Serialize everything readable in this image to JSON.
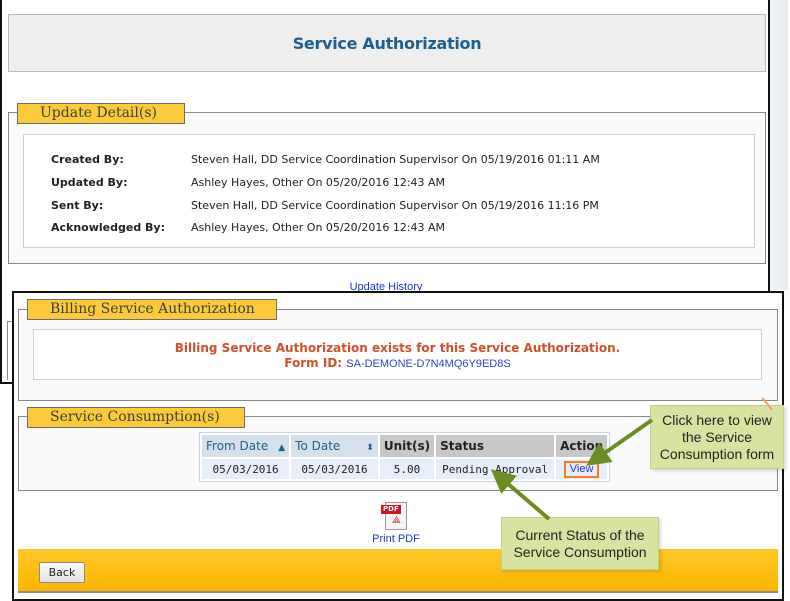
{
  "page": {
    "title": "Service Authorization"
  },
  "update_details": {
    "legend": "Update Detail(s)",
    "rows": [
      {
        "label": "Created By:",
        "value": "Steven Hall, DD Service Coordination Supervisor On 05/19/2016 01:11 AM"
      },
      {
        "label": "Updated By:",
        "value": "Ashley Hayes, Other On 05/20/2016 12:43 AM"
      },
      {
        "label": "Sent By:",
        "value": "Steven Hall, DD Service Coordination Supervisor On 05/19/2016 11:16 PM"
      },
      {
        "label": "Acknowledged By:",
        "value": "Ashley Hayes, Other On 05/20/2016 12:43 AM"
      }
    ],
    "history_link": "Update History"
  },
  "billing": {
    "legend": "Billing Service Authorization",
    "message": "Billing Service Authorization exists for this Service Authorization.",
    "form_id_label": "Form ID:",
    "form_id": "SA-DEMONE-D7N4MQ6Y9ED8S"
  },
  "consumption": {
    "legend": "Service Consumption(s)",
    "columns": [
      {
        "label": "From Date",
        "sort": "ascending",
        "sort_icon": "▲"
      },
      {
        "label": "To Date",
        "sort": "sortable",
        "sort_icon": "⬍"
      },
      {
        "label": "Unit(s)"
      },
      {
        "label": "Status"
      },
      {
        "label": "Action"
      }
    ],
    "rows": [
      {
        "from_date": "05/03/2016",
        "to_date": "05/03/2016",
        "units": "5.00",
        "status": "Pending Approval",
        "action": "View"
      }
    ]
  },
  "actions": {
    "print_pdf": "Print PDF",
    "pdf_icon_text": "PDF",
    "back": "Back"
  },
  "callouts": {
    "view_hint": "Click here to view the Service Consumption form",
    "status_hint": "Current Status of the Service Consumption"
  },
  "colors": {
    "legend_bg": "#fdcb3a",
    "title_text": "#1d5f8e",
    "message_text": "#d0502a",
    "link": "#1f36d6",
    "callout_bg": "#d8e3a2",
    "arrow": "#6b8e23",
    "footer": "#ffb400"
  }
}
